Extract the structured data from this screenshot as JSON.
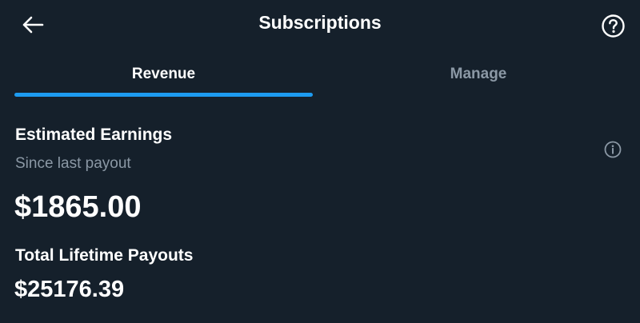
{
  "header": {
    "title": "Subscriptions",
    "back_icon": "arrow-left-icon",
    "help_icon": "question-circle-icon"
  },
  "tabs": [
    {
      "label": "Revenue",
      "active": true
    },
    {
      "label": "Manage",
      "active": false
    }
  ],
  "earnings": {
    "label": "Estimated Earnings",
    "sublabel": "Since last payout",
    "amount": "$1865.00",
    "info_icon": "info-circle-icon"
  },
  "lifetime": {
    "label": "Total Lifetime Payouts",
    "amount": "$25176.39"
  },
  "colors": {
    "background": "#15202b",
    "accent": "#1d9bf0",
    "text_primary": "#ffffff",
    "text_secondary": "#8b98a5"
  }
}
